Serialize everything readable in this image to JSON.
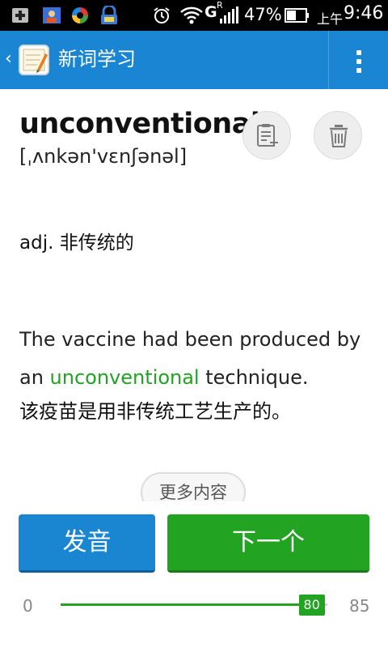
{
  "status_bar": {
    "battery_percent": "47%",
    "time_prefix": "上午",
    "time": "9:46",
    "network_label": "G",
    "roaming_label": "R"
  },
  "action_bar": {
    "title": "新词学习",
    "bg_color": "#1a86d3"
  },
  "word": {
    "text": "unconventional",
    "phonetic": "[ˌʌnkən'vɛnʃənəl]"
  },
  "definition": "adj. 非传统的",
  "example": {
    "before": "The vaccine had been produced by an ",
    "highlight": "unconventional",
    "after": " technique.",
    "translation": "该疫苗是用非传统工艺生产的。",
    "highlight_color": "#22a322"
  },
  "more_button": "更多内容",
  "buttons": {
    "pronounce": "发音",
    "next": "下一个"
  },
  "progress": {
    "min": "0",
    "max": "85",
    "value": "80",
    "value_num": 80,
    "max_num": 85
  }
}
